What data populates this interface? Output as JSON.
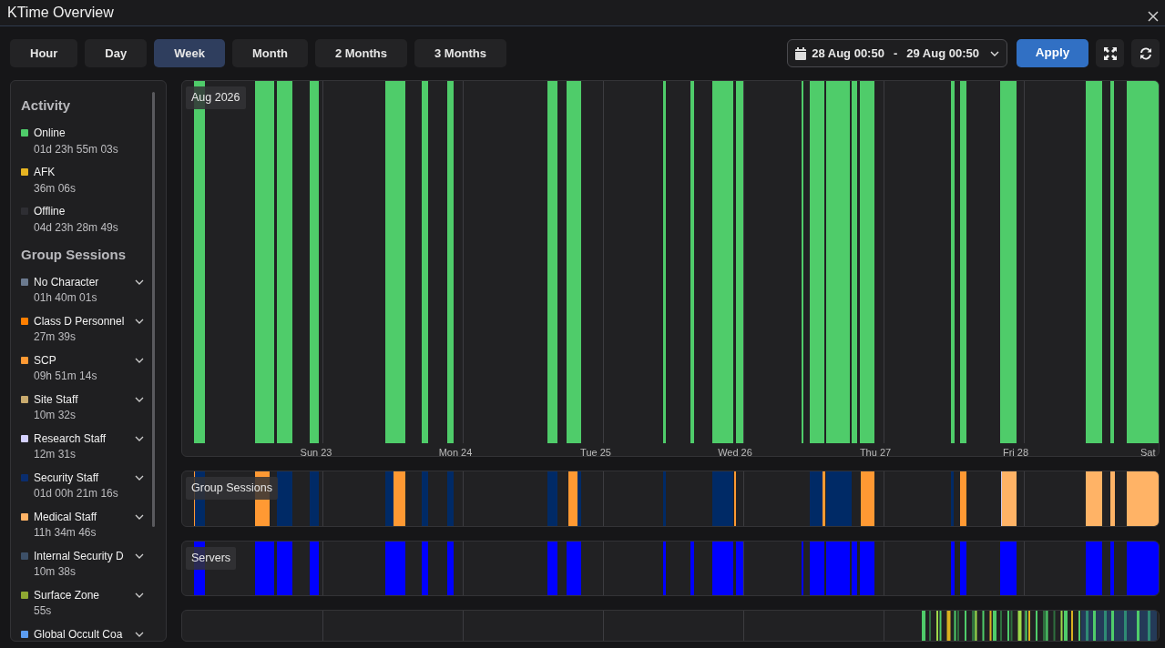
{
  "window": {
    "title": "KTime Overview"
  },
  "range_buttons": [
    {
      "label": "Hour",
      "selected": false
    },
    {
      "label": "Day",
      "selected": false
    },
    {
      "label": "Week",
      "selected": true
    },
    {
      "label": "Month",
      "selected": false
    },
    {
      "label": "2 Months",
      "selected": false
    },
    {
      "label": "3 Months",
      "selected": false
    }
  ],
  "date_range": {
    "start": "28 Aug 00:50",
    "separator": "-",
    "end": "29 Aug 00:50"
  },
  "apply_button": "Apply",
  "sidebar": {
    "sections": [
      {
        "heading": "Activity",
        "items": [
          {
            "name": "Online",
            "duration": "01d 23h 55m 03s",
            "color": "#4fcc6a",
            "expandable": false
          },
          {
            "name": "AFK",
            "duration": "36m 06s",
            "color": "#e6b422",
            "expandable": false
          },
          {
            "name": "Offline",
            "duration": "04d 23h 28m 49s",
            "color": "#2e2e33",
            "expandable": false
          }
        ]
      },
      {
        "heading": "Group Sessions",
        "items": [
          {
            "name": "No Character",
            "duration": "01h 40m 01s",
            "color": "#6b7a8f",
            "expandable": true
          },
          {
            "name": "Class D Personnel",
            "duration": "27m 39s",
            "color": "#ff7f00",
            "expandable": true
          },
          {
            "name": "SCP",
            "duration": "09h 51m 14s",
            "color": "#ff9933",
            "expandable": true
          },
          {
            "name": "Site Staff",
            "duration": "10m 32s",
            "color": "#c8aa6e",
            "expandable": true
          },
          {
            "name": "Research Staff",
            "duration": "12m 31s",
            "color": "#d4d0ff",
            "expandable": true
          },
          {
            "name": "Security Staff",
            "duration": "01d 00h 21m 16s",
            "color": "#0a2d6e",
            "expandable": true
          },
          {
            "name": "Medical Staff",
            "duration": "11h 34m 46s",
            "color": "#ffb366",
            "expandable": true
          },
          {
            "name": "Internal Security D",
            "duration": "10m 38s",
            "color": "#3d5068",
            "expandable": true
          },
          {
            "name": "Surface Zone",
            "duration": "55s",
            "color": "#8fa832",
            "expandable": true
          },
          {
            "name": "Global Occult Coa",
            "color": "#5b9cf0",
            "expandable": true
          }
        ]
      }
    ]
  },
  "charts": {
    "activity_label": "Aug 2026",
    "axis_labels": [
      "Sun 23",
      "Mon 24",
      "Tue 25",
      "Wed 26",
      "Thu 27",
      "Fri 28",
      "Sat"
    ],
    "group_label": "Group Sessions",
    "servers_label": "Servers"
  }
}
